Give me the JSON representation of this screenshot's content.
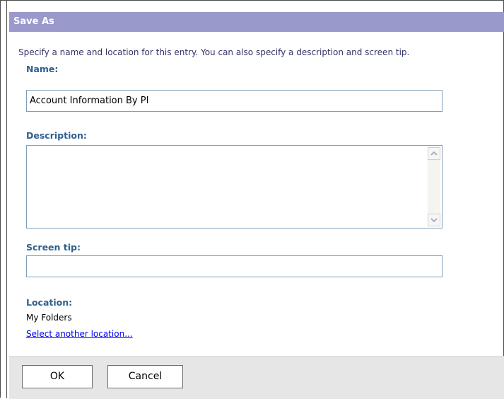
{
  "dialog": {
    "title": "Save As",
    "intro": "Specify a name and location for this entry. You can also specify a description and screen tip."
  },
  "fields": {
    "name_label": "Name:",
    "name_value": "Account Information By PI",
    "description_label": "Description:",
    "description_value": "",
    "screentip_label": "Screen tip:",
    "screentip_value": ""
  },
  "location": {
    "label": "Location:",
    "value": "My Folders",
    "link": "Select another location..."
  },
  "buttons": {
    "ok": "OK",
    "cancel": "Cancel"
  },
  "icons": {
    "scroll_up": "scroll-up-arrow-icon",
    "scroll_down": "scroll-down-arrow-icon"
  },
  "colors": {
    "title_bar": "#9999cc",
    "label": "#2f5f8f",
    "link": "#0000ee",
    "footer": "#e6e6e6"
  }
}
